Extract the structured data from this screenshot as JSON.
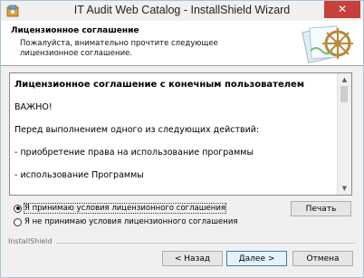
{
  "window": {
    "title": "IT Audit Web Catalog - InstallShield Wizard",
    "close_glyph": "✕"
  },
  "header": {
    "title": "Лицензионное соглашение",
    "subtitle": "Пожалуйста, внимательно прочтите следующее лицензионное соглашение."
  },
  "license": {
    "heading": "Лицензионное соглашение с конечным пользователем",
    "lines": [
      "ВАЖНО!",
      "Перед выполнением одного из следующих действий:",
      "- приобретение права на использование программы",
      "- использование Программы"
    ]
  },
  "options": {
    "accept_label": "Я принимаю условия лицензионного соглашения",
    "decline_label": "Я не принимаю условия лицензионного соглашения",
    "selected": "accept"
  },
  "buttons": {
    "print": "Печать",
    "back": "< Назад",
    "next": "Далее >",
    "cancel": "Отмена"
  },
  "footer": {
    "group_label": "InstallShield"
  },
  "colors": {
    "close_button": "#c7403a",
    "default_button_border": "#3c7fb1"
  }
}
